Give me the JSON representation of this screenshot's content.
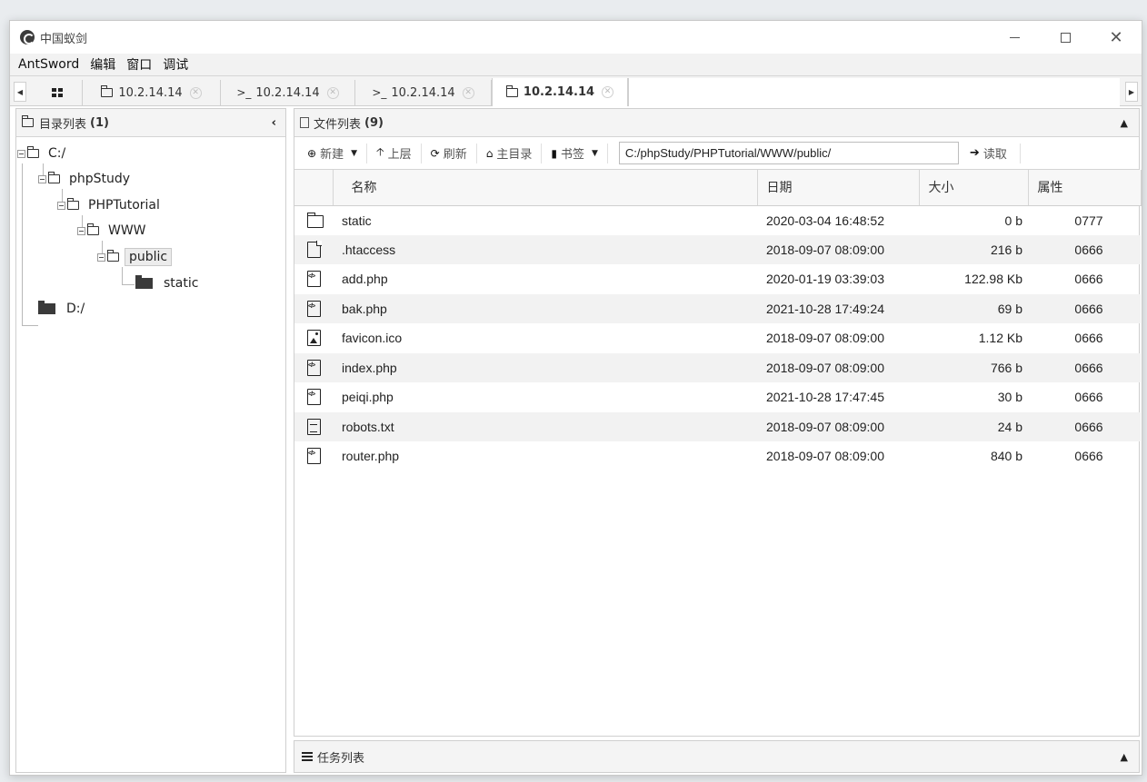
{
  "window": {
    "title": "中国蚁剑",
    "controls": {
      "minimize": "—",
      "maximize": "☐",
      "close": "✕"
    }
  },
  "menu": [
    "AntSword",
    "编辑",
    "窗口",
    "调试"
  ],
  "tabs": [
    {
      "type": "folder",
      "label": "10.2.14.14",
      "active": false
    },
    {
      "type": "terminal",
      "label": "10.2.14.14",
      "active": false
    },
    {
      "type": "terminal",
      "label": "10.2.14.14",
      "active": false
    },
    {
      "type": "folder",
      "label": "10.2.14.14",
      "active": true
    }
  ],
  "dir_panel": {
    "title": "目录列表",
    "count": "(1)",
    "collapse_glyph": "‹",
    "tree": [
      {
        "label": "C:/",
        "selected": false
      },
      {
        "label": "phpStudy",
        "selected": false
      },
      {
        "label": "PHPTutorial",
        "selected": false
      },
      {
        "label": "WWW",
        "selected": false
      },
      {
        "label": "public",
        "selected": true
      },
      {
        "label": "static",
        "selected": false
      },
      {
        "label": "D:/",
        "selected": false
      }
    ]
  },
  "file_panel": {
    "title": "文件列表",
    "count": "(9)",
    "toolbar": {
      "new": "新建",
      "up": "上层",
      "refresh": "刷新",
      "home": "主目录",
      "bookmark": "书签",
      "path": "C:/phpStudy/PHPTutorial/WWW/public/",
      "read": "读取"
    },
    "columns": [
      "名称",
      "日期",
      "大小",
      "属性"
    ],
    "files": [
      {
        "icon": "folder",
        "name": "static",
        "date": "2020-03-04 16:48:52",
        "size": "0 b",
        "attr": "0777"
      },
      {
        "icon": "file",
        "name": ".htaccess",
        "date": "2018-09-07 08:09:00",
        "size": "216 b",
        "attr": "0666"
      },
      {
        "icon": "code",
        "name": "add.php",
        "date": "2020-01-19 03:39:03",
        "size": "122.98 Kb",
        "attr": "0666"
      },
      {
        "icon": "code",
        "name": "bak.php",
        "date": "2021-10-28 17:49:24",
        "size": "69 b",
        "attr": "0666"
      },
      {
        "icon": "image",
        "name": "favicon.ico",
        "date": "2018-09-07 08:09:00",
        "size": "1.12 Kb",
        "attr": "0666"
      },
      {
        "icon": "code",
        "name": "index.php",
        "date": "2018-09-07 08:09:00",
        "size": "766 b",
        "attr": "0666"
      },
      {
        "icon": "code",
        "name": "peiqi.php",
        "date": "2021-10-28 17:47:45",
        "size": "30 b",
        "attr": "0666"
      },
      {
        "icon": "text",
        "name": "robots.txt",
        "date": "2018-09-07 08:09:00",
        "size": "24 b",
        "attr": "0666"
      },
      {
        "icon": "code",
        "name": "router.php",
        "date": "2018-09-07 08:09:00",
        "size": "840 b",
        "attr": "0666"
      }
    ]
  },
  "task_panel": {
    "title": "任务列表"
  }
}
